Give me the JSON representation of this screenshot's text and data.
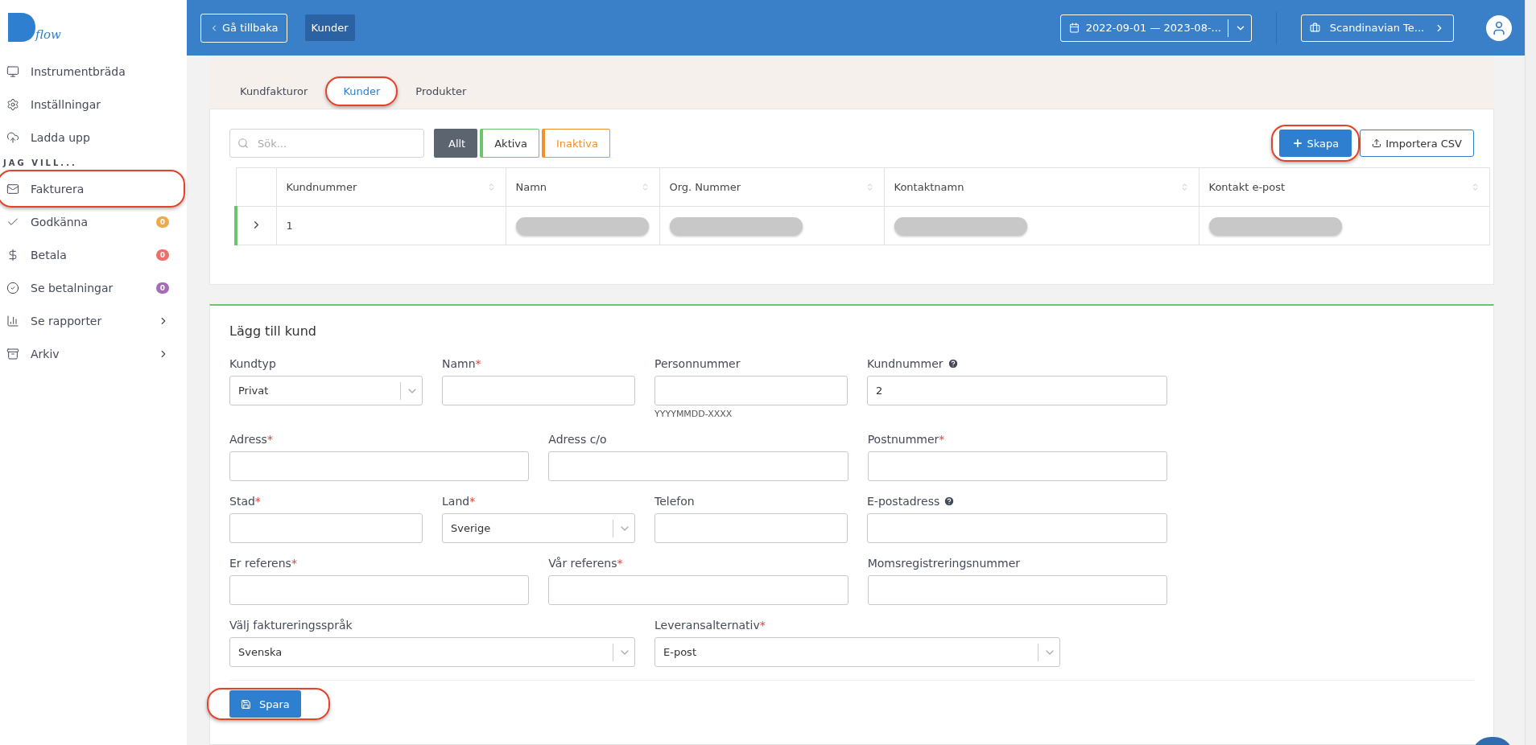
{
  "sidebar": {
    "logo_text": "flow",
    "items": [
      {
        "label": "Instrumentbräda",
        "selected": false,
        "circled": false
      },
      {
        "label": "Inställningar",
        "selected": false,
        "circled": false
      },
      {
        "label": "Ladda upp",
        "selected": false,
        "circled": false
      }
    ],
    "section_title": "JAG VILL...",
    "section_items": [
      {
        "label": "Fakturera",
        "selected": false,
        "circled": true
      },
      {
        "label": "Godkänna",
        "badge": "0",
        "color": "#eeaa4a",
        "circled": false,
        "selected": false
      },
      {
        "label": "Betala",
        "badge": "0",
        "color": "#ee6f6a",
        "circled": false,
        "selected": false
      },
      {
        "label": "Se betalningar",
        "badge": "0",
        "color": "#a46bb8",
        "circled": false,
        "selected": false
      },
      {
        "label": "Se rapporter",
        "expandable": true,
        "circled": false,
        "selected": false
      },
      {
        "label": "Arkiv",
        "expandable": true,
        "circled": false,
        "selected": false
      }
    ]
  },
  "topbar": {
    "back_button": "Gå tillbaka",
    "breadcrumb": "Kunder",
    "date_range": "2022-09-01 — 2023-08-...",
    "company": "Scandinavian Te..."
  },
  "tabs": [
    {
      "label": "Kundfakturor",
      "selected": false,
      "circled": false
    },
    {
      "label": "Kunder",
      "selected": true,
      "circled": true
    },
    {
      "label": "Produkter",
      "selected": false,
      "circled": false
    }
  ],
  "search": {
    "placeholder": "Sök..."
  },
  "filters": [
    {
      "label": "Allt",
      "selected": true,
      "color": "#5c6470"
    },
    {
      "label": "Aktiva",
      "selected": false,
      "color": "#6cc46c"
    },
    {
      "label": "Inaktiva",
      "selected": false,
      "color": "#f4902c"
    }
  ],
  "create_button": {
    "label": "Skapa",
    "circled": true
  },
  "import_button": {
    "label": "Importera CSV"
  },
  "table": {
    "columns": [
      "Kundnummer",
      "Namn",
      "Org. Nummer",
      "Kontaktnamn",
      "Kontakt e-post"
    ],
    "rows": [
      {
        "expanded": false,
        "color": "#6cc46c",
        "cells": [
          {
            "kind": "text",
            "text": "1"
          },
          {
            "kind": "redacted"
          },
          {
            "kind": "redacted"
          },
          {
            "kind": "redacted"
          },
          {
            "kind": "redacted"
          }
        ]
      }
    ]
  },
  "form": {
    "title": "Lägg till kund",
    "rows": [
      [
        {
          "label": "Kundtyp",
          "kind": "select",
          "value": "Privat"
        },
        {
          "label": "Namn",
          "kind": "input",
          "required_mark": "*"
        },
        {
          "label": "Personnummer",
          "kind": "input",
          "hint": "YYYYMMDD-XXXX"
        },
        {
          "label": "Kundnummer",
          "kind": "input",
          "value": "2",
          "help": true
        }
      ],
      [
        {
          "label": "Adress",
          "kind": "input",
          "required_mark": "*"
        },
        {
          "label": "Adress c/o",
          "kind": "input"
        },
        {
          "label": "Postnummer",
          "kind": "input",
          "required_mark": "*"
        }
      ],
      [
        {
          "label": "Stad",
          "kind": "input",
          "required_mark": "*"
        },
        {
          "label": "Land",
          "kind": "select",
          "value": "Sverige",
          "required_mark": "*"
        },
        {
          "label": "Telefon",
          "kind": "input"
        },
        {
          "label": "E-postadress",
          "kind": "input",
          "help": true
        }
      ],
      [
        {
          "label": "Er referens",
          "kind": "input",
          "required_mark": "*"
        },
        {
          "label": "Vår referens",
          "kind": "input",
          "required_mark": "*"
        },
        {
          "label": "Momsregistreringsnummer",
          "kind": "input"
        }
      ],
      [
        {
          "label": "Välj faktureringsspråk",
          "kind": "select",
          "value": "Svenska"
        },
        {
          "label": "Leveransalternativ",
          "kind": "select",
          "value": "E-post",
          "required_mark": "*"
        }
      ]
    ],
    "save_button": {
      "label": "Spara",
      "circled": true
    }
  }
}
